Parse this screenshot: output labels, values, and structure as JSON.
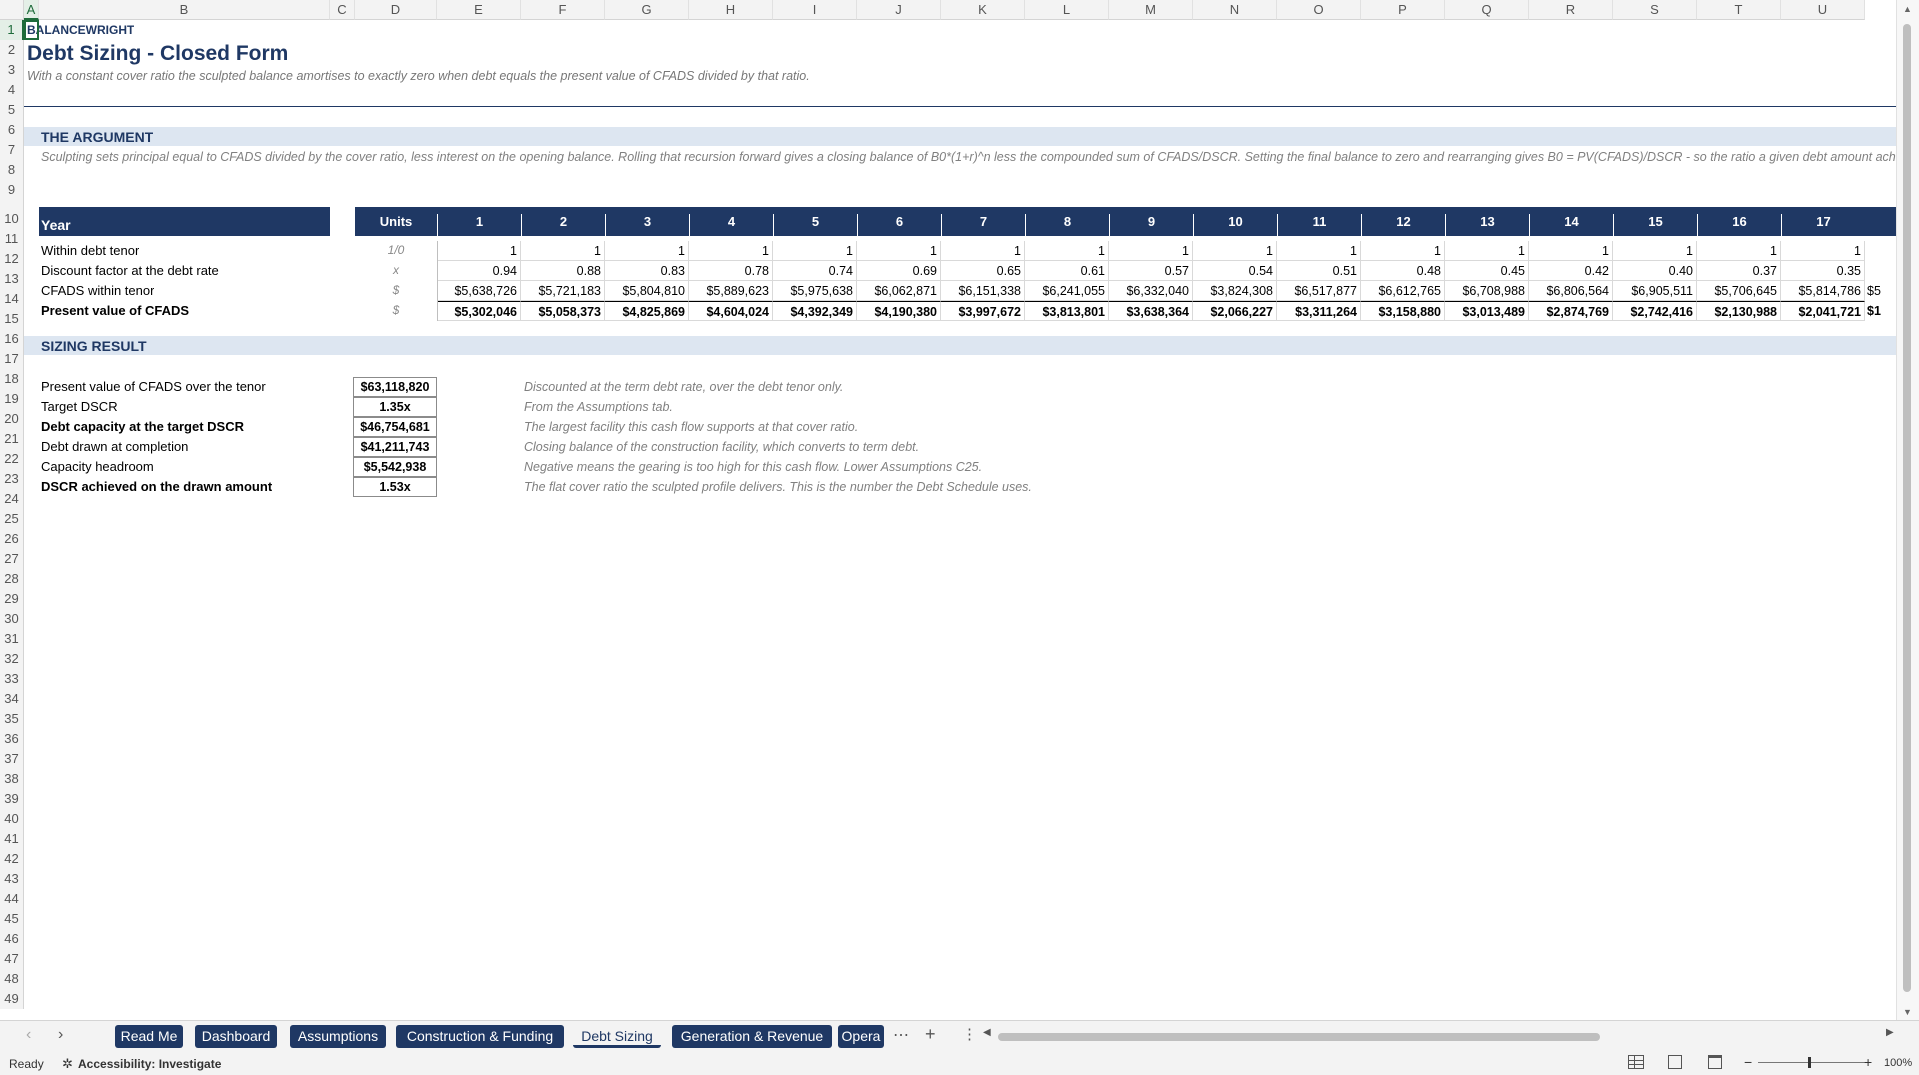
{
  "columns": [
    "A",
    "B",
    "C",
    "D",
    "E",
    "F",
    "G",
    "H",
    "I",
    "J",
    "K",
    "L",
    "M",
    "N",
    "O",
    "P",
    "Q",
    "R",
    "S",
    "T",
    "U"
  ],
  "rows_visible": 49,
  "brand": "BALANCEWRIGHT",
  "title": "Debt Sizing - Closed Form",
  "subtitle": "With a constant cover ratio the sculpted balance amortises to exactly zero when debt equals the present value of CFADS divided by that ratio.",
  "argument": {
    "heading": "THE ARGUMENT",
    "text": "Sculpting sets principal equal to CFADS divided by the cover ratio, less interest on the opening balance. Rolling that recursion forward gives a closing balance of B0*(1+r)^n less the compounded sum of CFADS/DSCR. Setting the final balance to zero and rearranging gives B0 = PV(CFADS)/DSCR - so the ratio a given debt amount achieves i"
  },
  "table": {
    "year_label": "Year",
    "units_header": "Units",
    "years": [
      "1",
      "2",
      "3",
      "4",
      "5",
      "6",
      "7",
      "8",
      "9",
      "10",
      "11",
      "12",
      "13",
      "14",
      "15",
      "16",
      "17"
    ],
    "rows": [
      {
        "label": "Within debt tenor",
        "unit": "1/0",
        "bold": false,
        "values": [
          "1",
          "1",
          "1",
          "1",
          "1",
          "1",
          "1",
          "1",
          "1",
          "1",
          "1",
          "1",
          "1",
          "1",
          "1",
          "1",
          "1"
        ],
        "extra": ""
      },
      {
        "label": "Discount factor at the debt rate",
        "unit": "x",
        "bold": false,
        "values": [
          "0.94",
          "0.88",
          "0.83",
          "0.78",
          "0.74",
          "0.69",
          "0.65",
          "0.61",
          "0.57",
          "0.54",
          "0.51",
          "0.48",
          "0.45",
          "0.42",
          "0.40",
          "0.37",
          "0.35"
        ],
        "extra": ""
      },
      {
        "label": "CFADS within tenor",
        "unit": "$",
        "bold": false,
        "values": [
          "$5,638,726",
          "$5,721,183",
          "$5,804,810",
          "$5,889,623",
          "$5,975,638",
          "$6,062,871",
          "$6,151,338",
          "$6,241,055",
          "$6,332,040",
          "$3,824,308",
          "$6,517,877",
          "$6,612,765",
          "$6,708,988",
          "$6,806,564",
          "$6,905,511",
          "$5,706,645",
          "$5,814,786"
        ],
        "extra": "$5"
      },
      {
        "label": "Present value of CFADS",
        "unit": "$",
        "bold": true,
        "values": [
          "$5,302,046",
          "$5,058,373",
          "$4,825,869",
          "$4,604,024",
          "$4,392,349",
          "$4,190,380",
          "$3,997,672",
          "$3,813,801",
          "$3,638,364",
          "$2,066,227",
          "$3,311,264",
          "$3,158,880",
          "$3,013,489",
          "$2,874,769",
          "$2,742,416",
          "$2,130,988",
          "$2,041,721"
        ],
        "extra": "$1"
      }
    ]
  },
  "sizing": {
    "heading": "SIZING RESULT",
    "items": [
      {
        "label": "Present value of CFADS over the tenor",
        "value": "$63,118,820",
        "note": "Discounted at the term debt rate, over the debt tenor only.",
        "bold": false
      },
      {
        "label": "Target DSCR",
        "value": "1.35x",
        "note": "From the Assumptions tab.",
        "bold": false
      },
      {
        "label": "Debt capacity at the target DSCR",
        "value": "$46,754,681",
        "note": "The largest facility this cash flow supports at that cover ratio.",
        "bold": true
      },
      {
        "label": "Debt drawn at completion",
        "value": "$41,211,743",
        "note": "Closing balance of the construction facility, which converts to term debt.",
        "bold": false
      },
      {
        "label": "Capacity headroom",
        "value": "$5,542,938",
        "note": "Negative means the gearing is too high for this cash flow. Lower Assumptions C25.",
        "bold": false
      },
      {
        "label": "DSCR achieved on the drawn amount",
        "value": "1.53x",
        "note": "The flat cover ratio the sculpted profile delivers. This is the number the Debt Schedule uses.",
        "bold": true
      }
    ]
  },
  "tabs": [
    "Read Me",
    "Dashboard",
    "Assumptions",
    "Construction & Funding",
    "Debt Sizing",
    "Generation & Revenue",
    "Opera"
  ],
  "active_tab": "Debt Sizing",
  "status": {
    "ready": "Ready",
    "accessibility": "Accessibility: Investigate",
    "zoom": "100%"
  }
}
